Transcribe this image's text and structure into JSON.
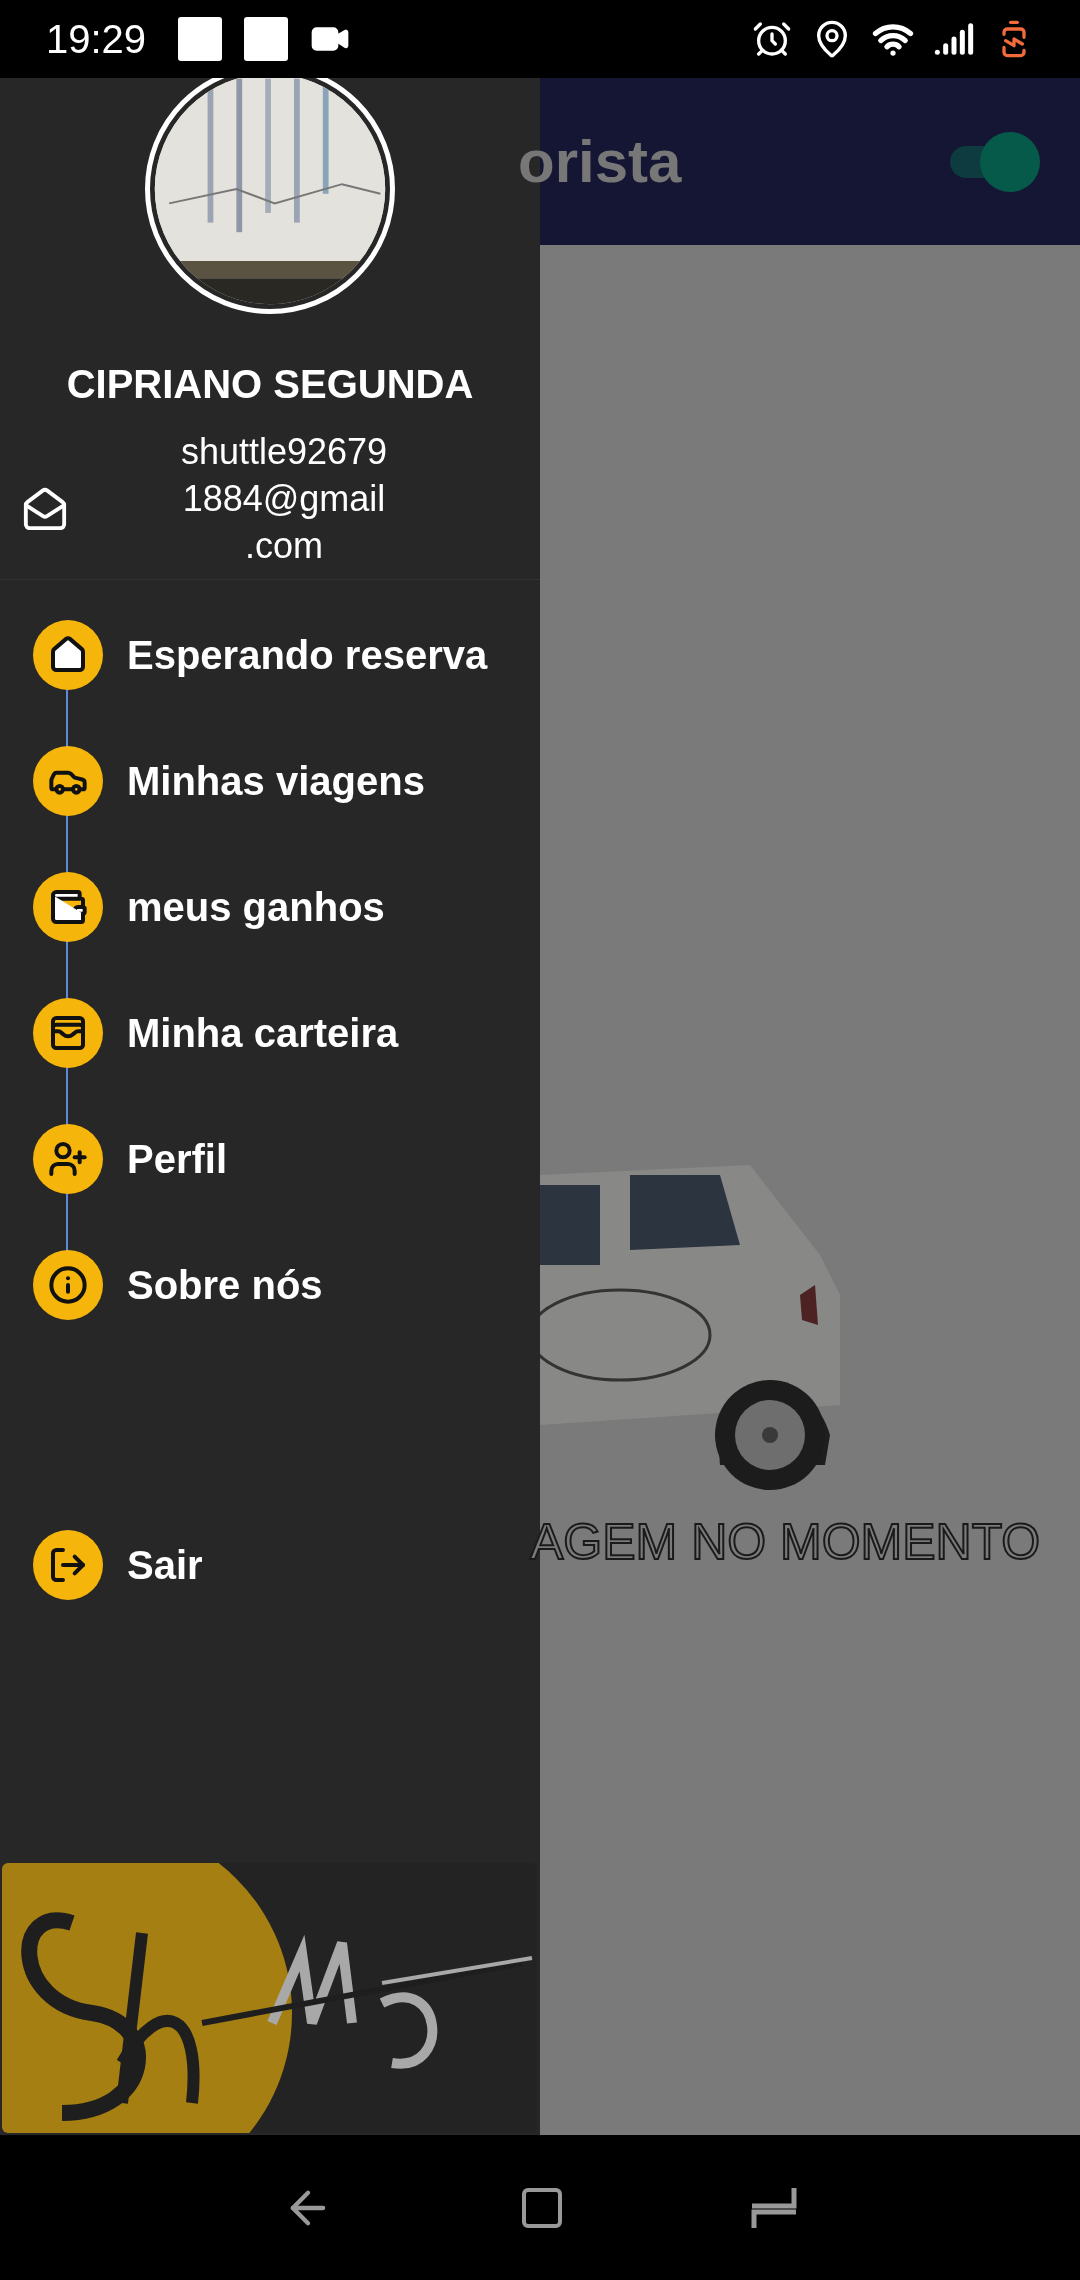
{
  "status_bar": {
    "time": "19:29"
  },
  "drawer": {
    "name": "CIPRIANO SEGUNDA",
    "email": "shuttle92679\n1884@gmail\n.com",
    "menu": [
      {
        "label": "Esperando reserva",
        "kind": "home"
      },
      {
        "label": "Minhas viagens",
        "kind": "car"
      },
      {
        "label": "meus ganhos",
        "kind": "wallet"
      },
      {
        "label": "Minha carteira",
        "kind": "purse"
      },
      {
        "label": "Perfil",
        "kind": "profile"
      },
      {
        "label": "Sobre nós",
        "kind": "info"
      }
    ],
    "logout": {
      "label": "Sair",
      "kind": "logout"
    }
  },
  "background_screen": {
    "title": "orista",
    "toggle": {
      "on": true
    },
    "message": "AGEM NO MOMENTO"
  }
}
